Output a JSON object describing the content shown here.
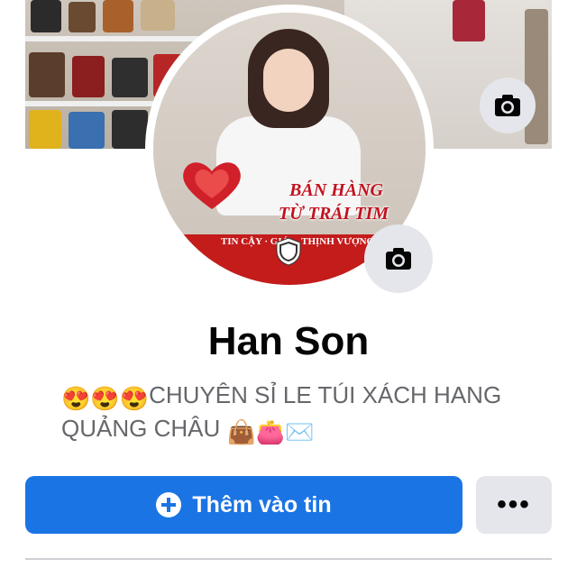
{
  "cover": {
    "camera_icon": "camera-icon"
  },
  "avatar": {
    "overlay_line1": "BÁN HÀNG",
    "overlay_line2": "TỪ TRÁI TIM",
    "overlay_tagline": "TIN CẬY · GIÁ ... THỊNH VƯỢNG",
    "shield_icon": "shield-icon",
    "camera_icon": "camera-icon"
  },
  "profile": {
    "name": "Han Son",
    "bio_emoji_prefix": "😍😍😍",
    "bio_text": "CHUYÊN SỈ LE TÚI XÁCH HANG QUẢNG CHÂU",
    "bio_emoji_suffix": "👜👛✉️"
  },
  "actions": {
    "add_story_label": "Thêm vào tin",
    "more_label": "•••"
  },
  "colors": {
    "primary": "#1b74e4",
    "secondary_button": "#e4e6eb",
    "text_secondary": "#65676b"
  }
}
